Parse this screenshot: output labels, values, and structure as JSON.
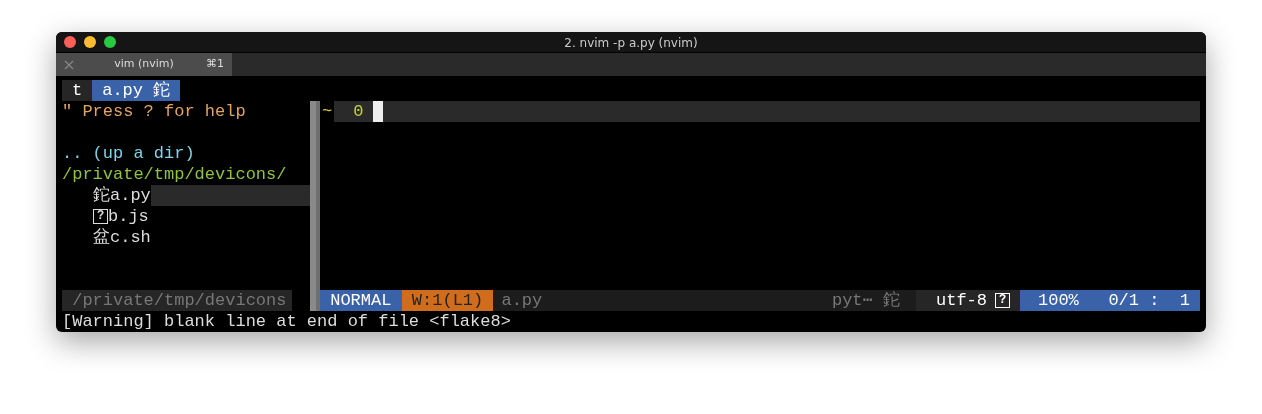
{
  "window": {
    "title": "2. nvim -p a.py (nvim)"
  },
  "tabs": [
    {
      "label": "vim (nvim)",
      "shortcut": "⌘1",
      "selected": true
    }
  ],
  "tabline": [
    {
      "label": "t",
      "selected": false
    },
    {
      "label": "a.py 鉈",
      "selected": true
    }
  ],
  "tree": {
    "help": "\" Press ? for help",
    "up": ".. (up a dir)",
    "root": "/private/tmp/devicons/",
    "files": [
      {
        "kind": "glyph",
        "icon": "鉈",
        "name": "a.py",
        "selected": true
      },
      {
        "kind": "boxed",
        "icon": "?",
        "name": "b.js",
        "selected": false
      },
      {
        "kind": "glyph",
        "icon": "盆",
        "name": "c.sh",
        "selected": false
      }
    ]
  },
  "editor": {
    "marker": "~",
    "line_number": "0"
  },
  "status": {
    "tree_path": "/private/tmp/devicons",
    "mode": "NORMAL",
    "warnings": "W:1(L1)",
    "file": "a.py",
    "filetype": "pyt⋯ 鉈",
    "encoding": "utf-8",
    "format_icon": "?",
    "percent": "100%",
    "position": "0/1 :  1"
  },
  "command_line": "[Warning] blank line at end of file <flake8>"
}
